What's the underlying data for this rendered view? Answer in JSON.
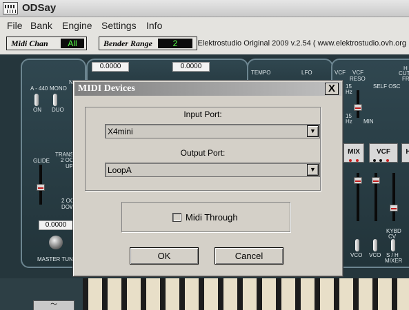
{
  "window": {
    "title": "ODSay"
  },
  "menu": {
    "items": [
      "File",
      "Bank",
      "Engine",
      "Settings",
      "Info"
    ]
  },
  "infobar": {
    "midi_chan_label": "Midi Chan",
    "midi_chan_value": "All",
    "bender_range_label": "Bender Range",
    "bender_range_value": "2",
    "version_text": "Elektrostudio Original 2009  v.2.54  ( www.elektrostudio.ovh.org"
  },
  "synth": {
    "value_displays": [
      "0.0000",
      "0.0000",
      "0.0000"
    ],
    "labels": {
      "a440": "A - 440",
      "on": "ON",
      "mono": "MONO",
      "duo": "DUO",
      "ni": "N",
      "glide": "GLIDE",
      "transpose": "TRANS",
      "two_oct_up": "2 OC",
      "up": "UP",
      "two_oct_down": "2 OC",
      "down": "DOW",
      "master_tune": "MASTER TUN",
      "tempo": "TEMPO",
      "lfo": "LFO",
      "vcf": "VCF",
      "vcf_reso": "VCF",
      "reso": "RESO",
      "self_osc": "SELF OSC",
      "hz15": "15",
      "hz": "Hz",
      "hz15b": "15",
      "hzb": "Hz",
      "min": "MIN",
      "h_label": "H",
      "cut": "CUT",
      "fr": "FR",
      "vco1": "VCO",
      "vco2": "VCO",
      "kybd": "KYBD",
      "sh": "S / H",
      "mixer": "MIXER",
      "cv": "CV"
    },
    "modules": [
      "MIX",
      "VCF",
      "H"
    ]
  },
  "dialog": {
    "title": "MIDI Devices",
    "close": "X",
    "input_port_label": "Input Port:",
    "input_port_value": "X4mini",
    "output_port_label": "Output Port:",
    "output_port_value": "LoopA",
    "midi_through_label": "Midi Through",
    "midi_through_checked": false,
    "ok_label": "OK",
    "cancel_label": "Cancel",
    "dropdown_arrow": "▼"
  }
}
